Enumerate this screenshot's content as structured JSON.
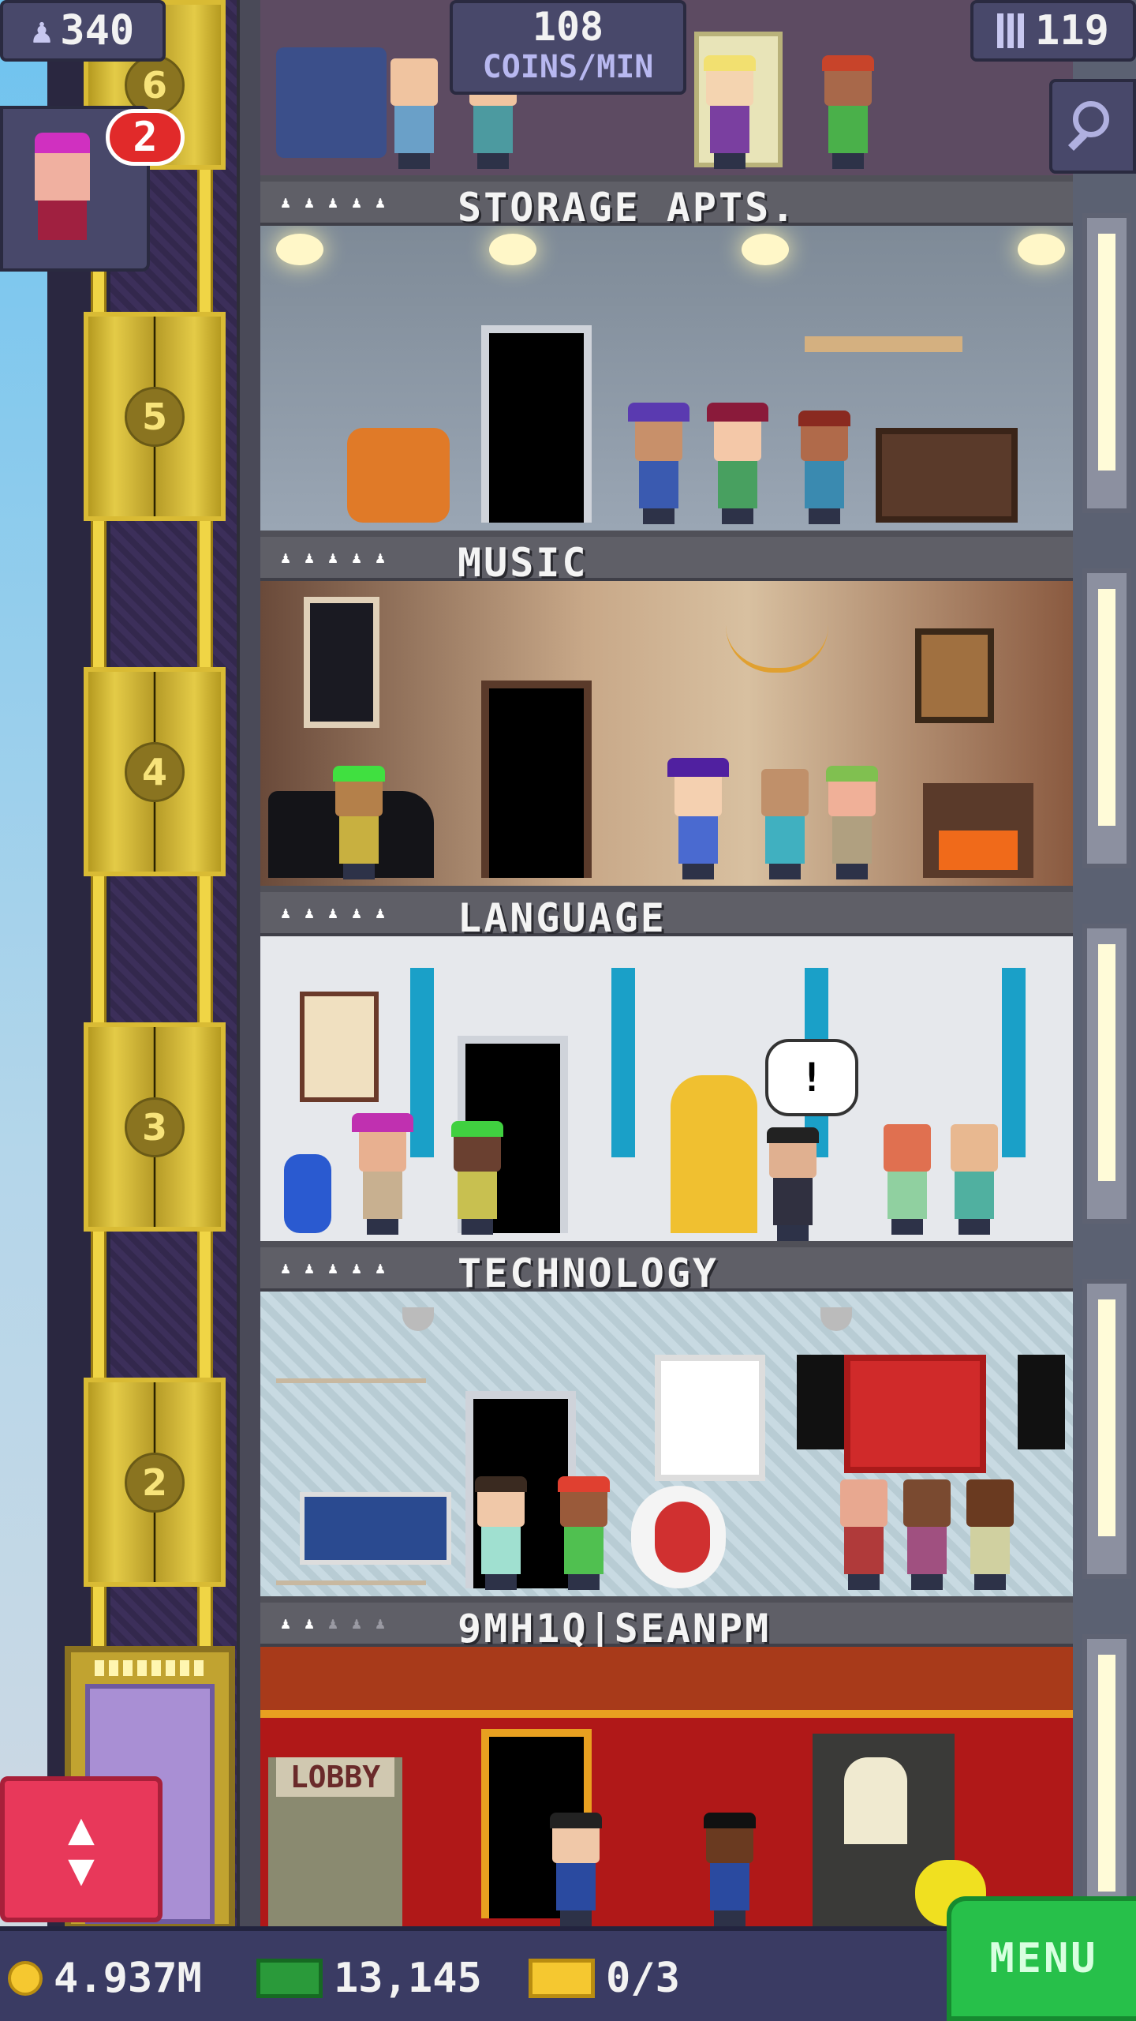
{
  "status": {
    "population": "340",
    "coins_rate_value": "108",
    "coins_rate_unit": "COINS/MIN",
    "floor_count": "119",
    "visitor_count": "2"
  },
  "floors": [
    {
      "name": "STORAGE APTS.",
      "stars_filled": 5,
      "stars_total": 5
    },
    {
      "name": "MUSIC",
      "stars_filled": 5,
      "stars_total": 5
    },
    {
      "name": "LANGUAGE",
      "stars_filled": 5,
      "stars_total": 5
    },
    {
      "name": "TECHNOLOGY",
      "stars_filled": 5,
      "stars_total": 5
    },
    {
      "name": "9MH1Q|SEANPM",
      "stars_filled": 2,
      "stars_total": 5
    }
  ],
  "room_signs": {
    "lobby_sign": "LOBBY",
    "language_speech": "!"
  },
  "elevator_floor_numbers": [
    "5",
    "4",
    "3",
    "2"
  ],
  "bottom_bar": {
    "coins": "4.937M",
    "bux": "13,145",
    "tickets": "0/3",
    "menu_label": "MENU"
  },
  "colors": {
    "accent_menu": "#27c04a",
    "elevator_button": "#e8385a",
    "panel": "#48486a",
    "coin": "#f5c830"
  },
  "icons": [
    "person-icon",
    "building-icon",
    "search-icon",
    "coin-icon",
    "cash-icon",
    "ticket-icon",
    "up-down-arrows-icon"
  ]
}
